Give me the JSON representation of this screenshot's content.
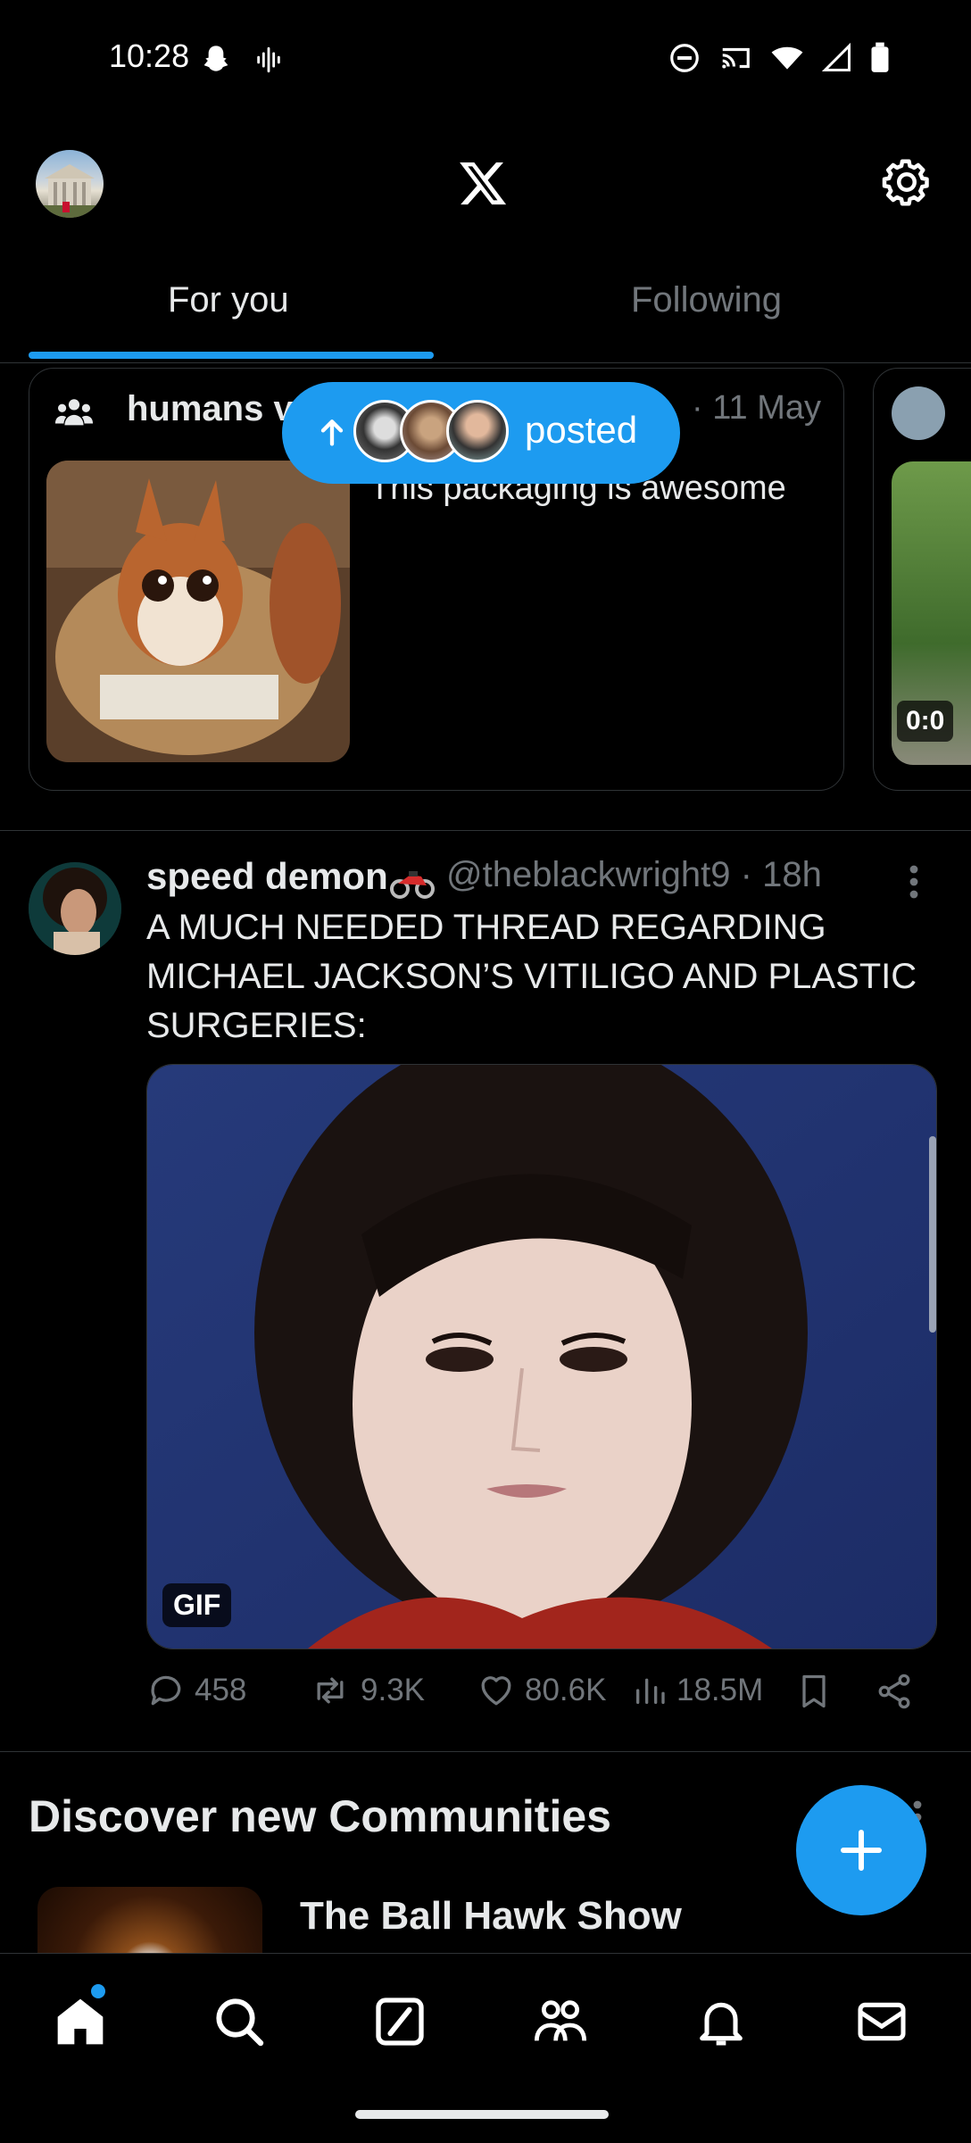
{
  "status_bar": {
    "time": "10:28"
  },
  "header": {
    "tabs": [
      {
        "label": "For you",
        "active": true
      },
      {
        "label": "Following",
        "active": false
      }
    ]
  },
  "community_card": {
    "title": "humans v",
    "date": "· 11 May",
    "text": "This packaging is awesome",
    "next_video_time": "0:0"
  },
  "new_posts_pill": {
    "label": "posted"
  },
  "post": {
    "name": "speed demon",
    "handle": "@theblackwright9 · 18h",
    "text": "A MUCH NEEDED THREAD REGARDING MICHAEL JACKSON’S VITILIGO AND PLASTIC SURGERIES:",
    "media_badge": "GIF",
    "stats": {
      "replies": "458",
      "reposts": "9.3K",
      "likes": "80.6K",
      "views": "18.5M"
    }
  },
  "discover": {
    "title": "Discover new Communities",
    "community_name": "The Ball Hawk Show"
  },
  "colors": {
    "accent": "#1d9bf0",
    "secondary_text": "#71767b",
    "primary_text": "#e7e9ea",
    "border": "#2f3336"
  },
  "icons": [
    "snapchat-icon",
    "voice-icon",
    "dnd-icon",
    "cast-icon",
    "wifi-icon",
    "signal-icon",
    "battery-icon",
    "x-logo-icon",
    "settings-gear-icon",
    "community-icon",
    "reply-icon",
    "repost-icon",
    "like-icon",
    "views-icon",
    "bookmark-icon",
    "share-icon",
    "compose-plus-icon",
    "home-icon",
    "search-icon",
    "grok-icon",
    "communities-icon",
    "notifications-icon",
    "messages-icon"
  ]
}
